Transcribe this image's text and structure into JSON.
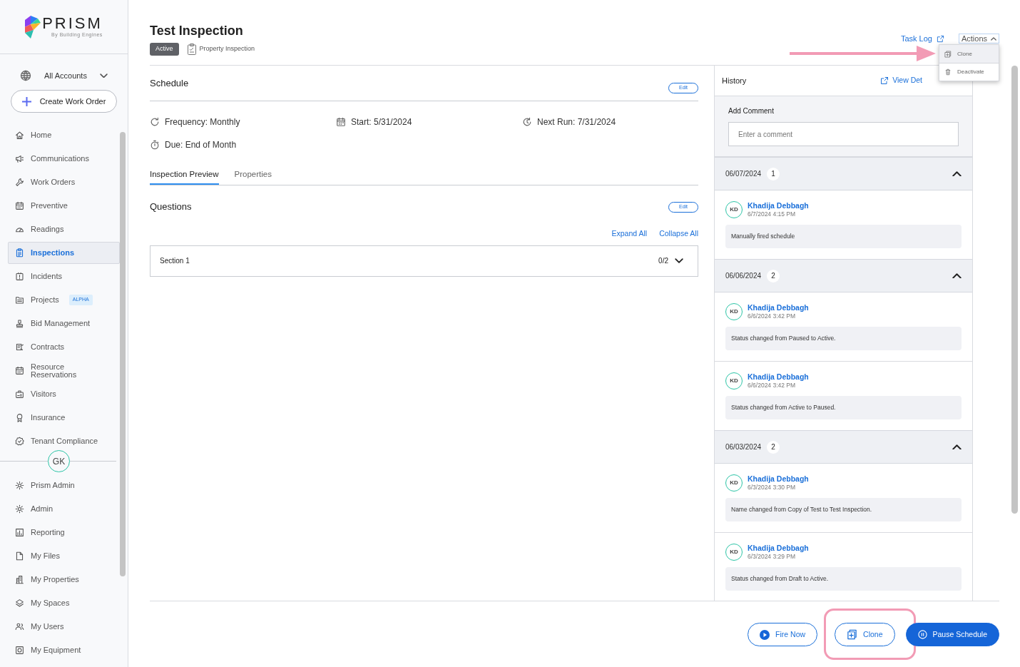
{
  "logo": {
    "name": "PRISM",
    "tagline": "By Building Engines"
  },
  "account": {
    "label": "All Accounts"
  },
  "create_button": "Create Work Order",
  "nav": [
    {
      "label": "Home",
      "selected": false
    },
    {
      "label": "Communications",
      "selected": false
    },
    {
      "label": "Work Orders",
      "selected": false
    },
    {
      "label": "Preventive",
      "selected": false
    },
    {
      "label": "Readings",
      "selected": false
    },
    {
      "label": "Inspections",
      "selected": true
    },
    {
      "label": "Incidents",
      "selected": false
    },
    {
      "label": "Projects",
      "selected": false,
      "badge": "ALPHA"
    },
    {
      "label": "Bid Management",
      "selected": false
    },
    {
      "label": "Contracts",
      "selected": false
    },
    {
      "label": "Resource Reservations",
      "selected": false
    },
    {
      "label": "Visitors",
      "selected": false
    },
    {
      "label": "Insurance",
      "selected": false
    },
    {
      "label": "Tenant Compliance",
      "selected": false
    }
  ],
  "user_avatar": "GK",
  "nav_bottom": [
    {
      "label": "Prism Admin",
      "selected": false
    },
    {
      "label": "Admin",
      "selected": false
    },
    {
      "label": "Reporting",
      "selected": false
    },
    {
      "label": "My Files",
      "selected": false
    },
    {
      "label": "My Properties",
      "selected": false
    },
    {
      "label": "My Spaces",
      "selected": false
    },
    {
      "label": "My Users",
      "selected": false
    },
    {
      "label": "My Equipment",
      "selected": false
    }
  ],
  "page": {
    "title": "Test Inspection",
    "status": "Active",
    "type": "Property Inspection"
  },
  "task_log": "Task Log",
  "actions": {
    "label": "Actions",
    "expanded": true
  },
  "actions_menu": [
    {
      "label": "Clone",
      "highlighted": true
    },
    {
      "label": "Deactivate",
      "highlighted": false
    }
  ],
  "schedule": {
    "title": "Schedule",
    "edit": "Edit",
    "fields": [
      "Frequency: Monthly",
      "Start: 5/31/2024",
      "Next Run: 7/31/2024",
      "Due: End of Month"
    ]
  },
  "tabs": [
    {
      "label": "Inspection Preview",
      "selected": true
    },
    {
      "label": "Properties",
      "selected": false
    }
  ],
  "questions": {
    "title": "Questions",
    "edit": "Edit",
    "expand_all": "Expand All",
    "collapse_all": "Collapse All",
    "sections": [
      {
        "title": "Section 1",
        "progress": "0/2",
        "expanded": false
      }
    ]
  },
  "history": {
    "title": "History",
    "detail_link": "View Det",
    "add_comment": "Add Comment",
    "placeholder": "Enter a comment",
    "groups": [
      {
        "date": "06/07/2024",
        "count": "1",
        "expanded": true,
        "entries": [
          {
            "initials": "KD",
            "author": "Khadija Debbagh",
            "time": "6/7/2024 4:15 PM",
            "message": "Manually fired schedule"
          }
        ]
      },
      {
        "date": "06/06/2024",
        "count": "2",
        "expanded": true,
        "entries": [
          {
            "initials": "KD",
            "author": "Khadija Debbagh",
            "time": "6/6/2024 3:42 PM",
            "message": "Status changed from Paused to Active."
          },
          {
            "initials": "KD",
            "author": "Khadija Debbagh",
            "time": "6/6/2024 3:42 PM",
            "message": "Status changed from Active to Paused."
          }
        ]
      },
      {
        "date": "06/03/2024",
        "count": "2",
        "expanded": true,
        "entries": [
          {
            "initials": "KD",
            "author": "Khadija Debbagh",
            "time": "6/3/2024 3:30 PM",
            "message": "Name changed from Copy of Test to Test Inspection."
          },
          {
            "initials": "KD",
            "author": "Khadija Debbagh",
            "time": "6/3/2024 3:29 PM",
            "message": "Status changed from Draft to Active."
          }
        ]
      }
    ]
  },
  "footer_buttons": [
    {
      "label": "Fire Now",
      "kind": "outline"
    },
    {
      "label": "Clone",
      "kind": "outline"
    },
    {
      "label": "Pause Schedule",
      "kind": "filled"
    }
  ]
}
